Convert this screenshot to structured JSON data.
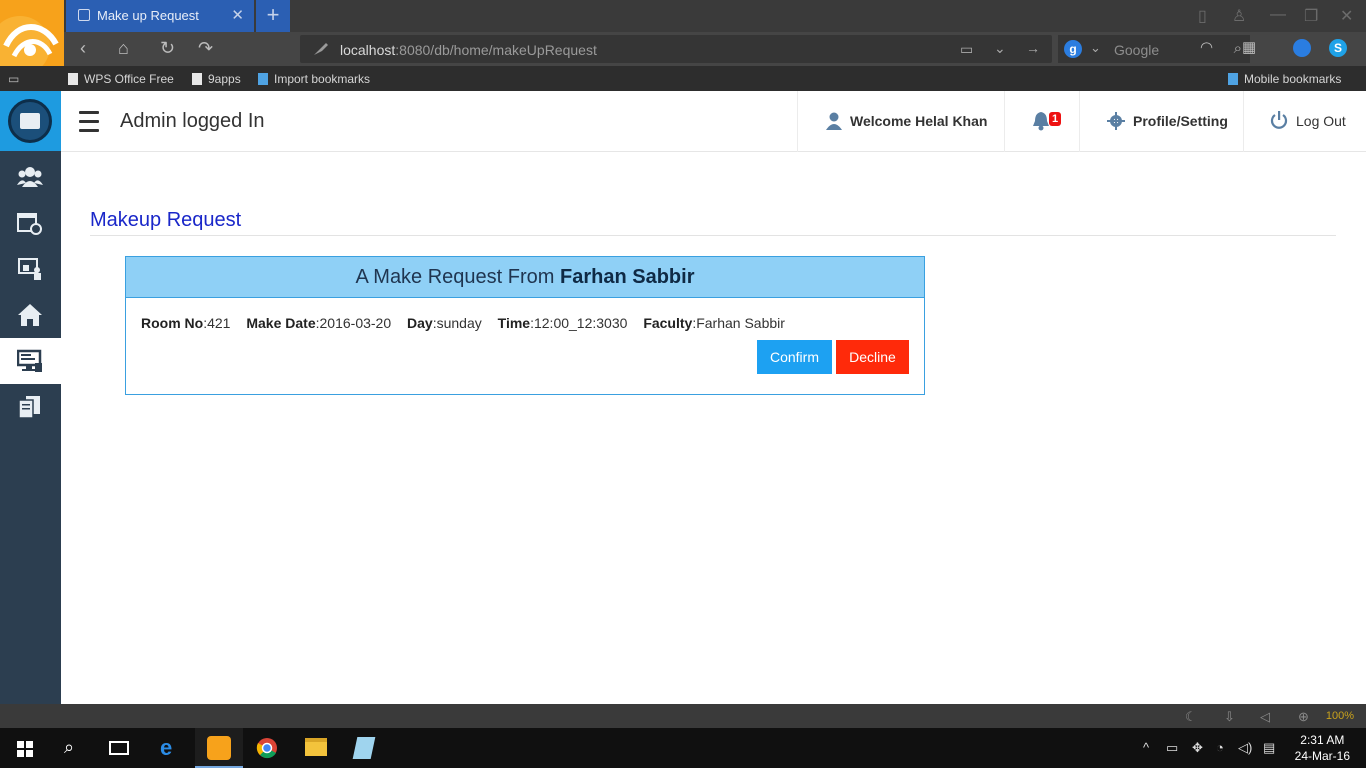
{
  "browser": {
    "tab_title": "Make up Request",
    "tab_close": "✕",
    "new_tab": "+",
    "url_host": "localhost",
    "url_rest": ":8080/db/home/makeUpRequest",
    "search_placeholder": "Google",
    "search_engine_letter": "g",
    "bookmarks": [
      "WPS Office Free",
      "9apps",
      "Import bookmarks"
    ],
    "mobile_bookmarks": "Mobile bookmarks"
  },
  "topbar": {
    "title": "Admin logged In",
    "welcome": "Welcome Helal Khan",
    "notification_count": "1",
    "profile": "Profile/Setting",
    "logout": "Log Out"
  },
  "page": {
    "heading": "Makeup Request"
  },
  "request": {
    "header_prefix": "A Make Request From ",
    "header_name": "Farhan Sabbir",
    "fields": [
      {
        "label": "Room No",
        "value": ":421"
      },
      {
        "label": "Make Date",
        "value": ":2016-03-20"
      },
      {
        "label": "Day",
        "value": ":sunday"
      },
      {
        "label": "Time",
        "value": ":12:00_12:3030"
      },
      {
        "label": "Faculty",
        "value": ":Farhan Sabbir"
      }
    ],
    "confirm_label": "Confirm",
    "decline_label": "Decline"
  },
  "status_bar": {
    "zoom": "100%"
  },
  "taskbar": {
    "time": "2:31 AM",
    "date": "24-Mar-16"
  },
  "colors": {
    "accent": "#1da1f2",
    "decline": "#ff2a0a",
    "heading": "#1a27c9",
    "card_header": "#8fd0f6",
    "sidebar": "#2c3e50"
  },
  "icons": {
    "sidebar": [
      "users-icon",
      "calendar-clock-icon",
      "teacher-board-icon",
      "home-icon",
      "desktop-list-icon",
      "documents-icon"
    ]
  }
}
